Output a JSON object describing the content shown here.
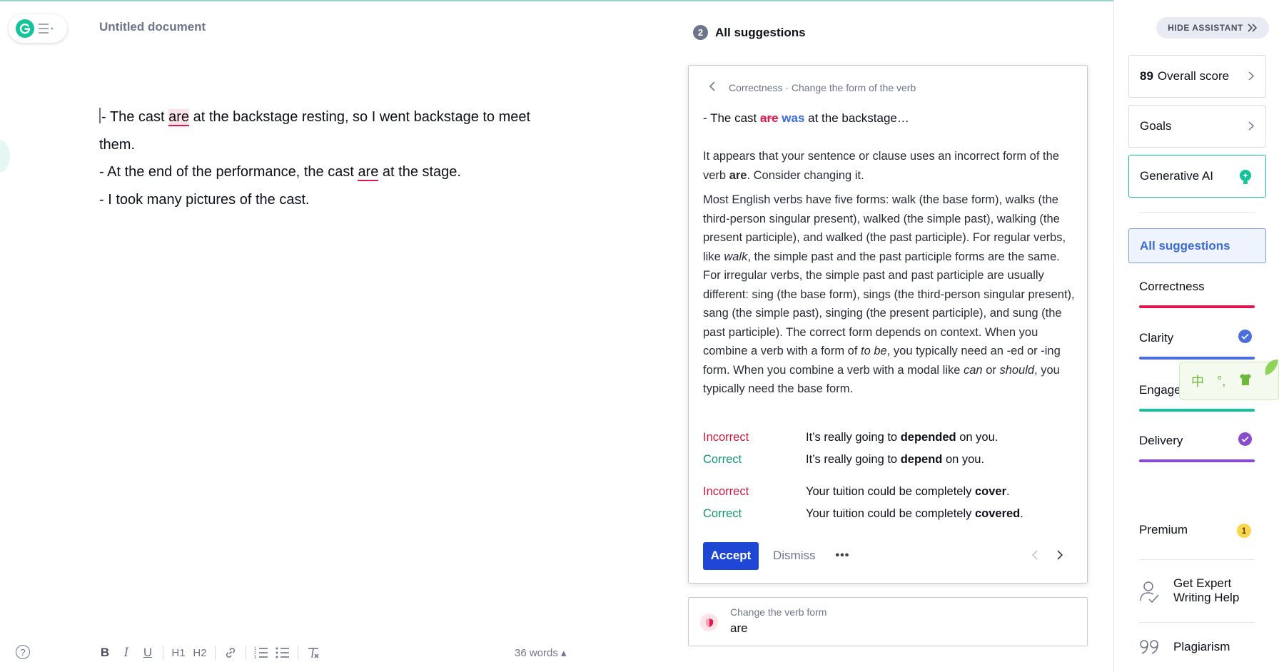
{
  "editor": {
    "doc_title": "Untitled document",
    "line1_a": "- The cast ",
    "line1_flag": "are",
    "line1_b": " at the backstage resting, so I went backstage to meet",
    "line1_c": "them.",
    "line2_a": "- At the end of the performance, the cast ",
    "line2_flag": "are",
    "line2_b": " at the stage.",
    "line3": "- I took many pictures of the cast.",
    "word_count": "36 words ▴",
    "help_glyph": "?",
    "toolbar": {
      "bold": "B",
      "italic": "I",
      "underline": "U",
      "h1": "H1",
      "h2": "H2"
    }
  },
  "suggestions": {
    "count": "2",
    "title": "All suggestions",
    "card": {
      "category": "Correctness · Change the form of the verb",
      "preview_prefix": "- The cast ",
      "preview_deleted": "are",
      "preview_inserted": "was",
      "preview_suffix": " at the backstage…",
      "expl1_a": "It appears that your sentence or clause uses an incorrect form of the verb ",
      "expl1_bold": "are",
      "expl1_b": ". Consider changing it.",
      "expl2_a": "Most English verbs have five forms: walk (the base form), walks (the third-person singular present), walked (the simple past), walking (the present participle), and walked (the past participle). For regular verbs, like ",
      "expl2_walk": "walk",
      "expl2_b": ", the simple past and the past participle forms are the same. For irregular verbs, the simple past and past participle are usually different: sing (the base form), sings (the third-person singular present), sang (the simple past), singing (the present participle), and sung (the past participle). The correct form depends on context. When you combine a verb with a form of ",
      "expl2_tobe": "to be",
      "expl2_c": ", you typically need an -ed or -ing form. When you combine a verb with a modal like ",
      "expl2_can": "can",
      "expl2_d": " or ",
      "expl2_should": "should",
      "expl2_e": ", you typically need the base form.",
      "examples": [
        {
          "label": "Incorrect",
          "a": "It’s really going to ",
          "bold": "depended",
          "b": " on you."
        },
        {
          "label": "Correct",
          "a": "It’s really going to ",
          "bold": "depend",
          "b": " on you."
        },
        {
          "label": "Incorrect",
          "a": "Your tuition could be completely ",
          "bold": "cover",
          "b": "."
        },
        {
          "label": "Correct",
          "a": "Your tuition could be completely ",
          "bold": "covered",
          "b": "."
        }
      ],
      "accept": "Accept",
      "dismiss": "Dismiss",
      "more": "•••"
    },
    "mini": {
      "subtitle": "Change the verb form",
      "word": "are"
    }
  },
  "sidebar": {
    "hide_assistant": "HIDE ASSISTANT",
    "overall_score_num": "89",
    "overall_score_label": "Overall score",
    "goals": "Goals",
    "generative_ai": "Generative AI",
    "all_suggestions": "All suggestions",
    "categories": [
      {
        "label": "Correctness",
        "color": "#e0184d"
      },
      {
        "label": "Clarity",
        "color": "#4a6ee0"
      },
      {
        "label": "Engage",
        "color": "#15c39a"
      },
      {
        "label": "Delivery",
        "color": "#8a4ad0"
      }
    ],
    "premium": "Premium",
    "premium_badge": "1",
    "expert_line1": "Get Expert",
    "expert_line2": "Writing Help",
    "plagiarism": "Plagiarism",
    "ime": {
      "zh": "中",
      "punct": "°,"
    }
  },
  "colors": {
    "brand_green": "#15c39a",
    "accept_blue": "#1f47d6",
    "error_red": "#e0184d"
  }
}
